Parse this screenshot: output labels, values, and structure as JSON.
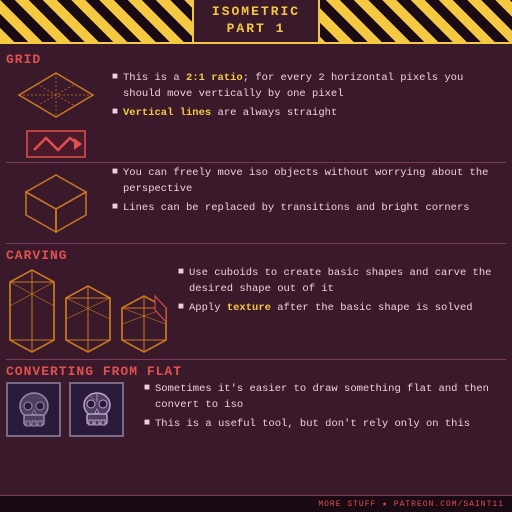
{
  "header": {
    "title_line1": "ISOMETRIC",
    "title_line2": "PART 1"
  },
  "sections": {
    "grid": {
      "label": "GRID",
      "bullets": [
        {
          "text": "This is a ",
          "highlight": "2:1 ratio",
          "text2": "; for every 2 horizontal pixels you should move vertically by one pixel"
        },
        {
          "highlight": "Vertical lines",
          "text": " are always straight"
        }
      ]
    },
    "iso_move": {
      "bullets": [
        {
          "text": "You can freely move iso objects without worrying about the perspective"
        },
        {
          "text": "Lines can be replaced by transitions and bright corners"
        }
      ]
    },
    "carving": {
      "label": "CARVING",
      "bullets": [
        {
          "text": "Use cuboids to create basic shapes and carve the desired shape out of it"
        },
        {
          "text": "Apply ",
          "highlight": "texture",
          "text2": " after the basic shape is solved"
        }
      ]
    },
    "converting": {
      "label": "CONVERTING FROM FLAT",
      "bullets": [
        {
          "text": "Sometimes it's easier to draw something flat and then convert to iso"
        },
        {
          "text": "This is a useful tool, but  don't rely only on this"
        }
      ]
    }
  },
  "footer": {
    "prefix": "MORE STUFF",
    "separator": "★",
    "url": "PATREON.COM/SAInt11"
  }
}
